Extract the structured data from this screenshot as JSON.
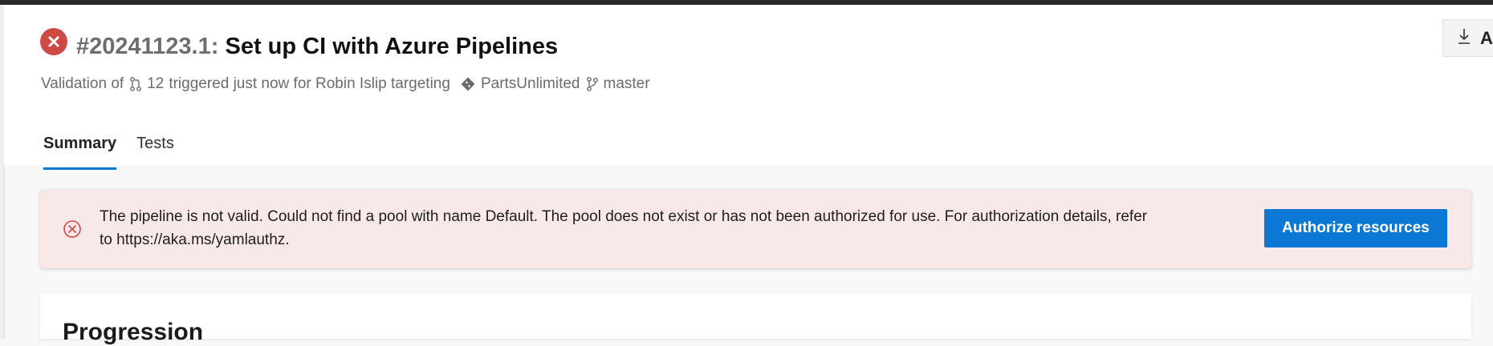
{
  "header": {
    "run_id": "#20241123.1",
    "separator": ":",
    "pipeline_name": "Set up CI with Azure Pipelines",
    "subtitle": {
      "prefix": "Validation of",
      "pr_number": "12",
      "trigger_text": "triggered just now for Robin Islip targeting",
      "repo": "PartsUnlimited",
      "branch": "master"
    },
    "download_label": "A"
  },
  "tabs": [
    {
      "label": "Summary",
      "active": true
    },
    {
      "label": "Tests",
      "active": false
    }
  ],
  "banner": {
    "message": "The pipeline is not valid. Could not find a pool with name Default. The pool does not exist or has not been authorized for use. For authorization details, refer to https://aka.ms/yamlauthz.",
    "button_label": "Authorize resources"
  },
  "progression": {
    "title": "Progression"
  },
  "colors": {
    "error": "#cd4a45",
    "accent": "#0078d4",
    "banner_bg": "#f8e8e8"
  }
}
